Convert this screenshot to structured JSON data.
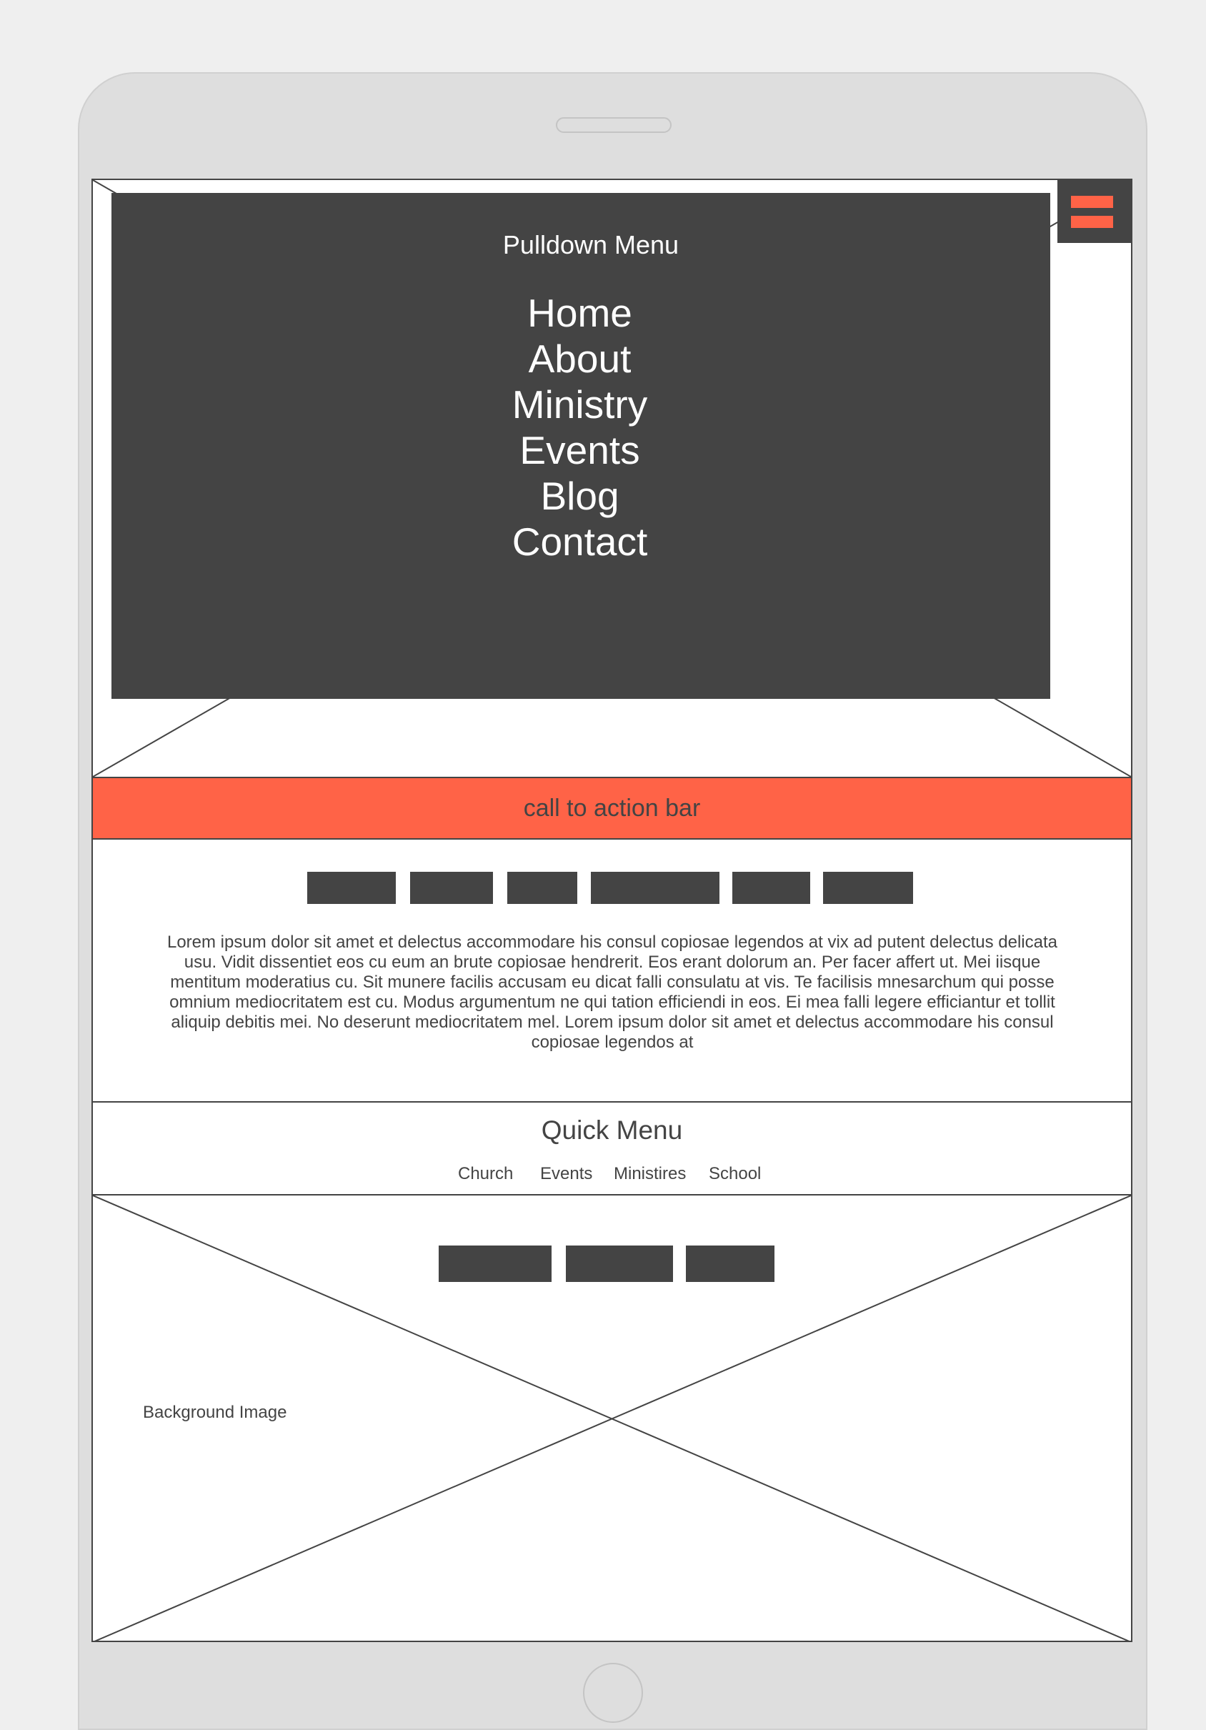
{
  "pulldown": {
    "title": "Pulldown Menu",
    "items": [
      "Home",
      "About",
      "Ministry",
      "Events",
      "Blog",
      "Contact"
    ]
  },
  "hamburger": {
    "icon": "hamburger-menu-icon"
  },
  "cta": {
    "label": "call to action bar"
  },
  "content": {
    "body": "Lorem ipsum dolor sit amet et delectus accommodare his consul copiosae legendos at vix ad putent delectus delicata usu. Vidit dissentiet eos cu eum an brute copiosae hendrerit. Eos erant dolorum an. Per facer affert ut. Mei iisque mentitum moderatius cu. Sit munere facilis accusam eu dicat falli consulatu at vis. Te facilisis mnesarchum qui posse omnium mediocritatem est cu. Modus argumentum ne qui tation efficiendi in eos. Ei mea falli legere efficiantur et tollit aliquip debitis mei. No deserunt mediocritatem mel. Lorem ipsum dolor sit amet et delectus accommodare his consul copiosae legendos at"
  },
  "quick_menu": {
    "title": "Quick Menu",
    "links": [
      "Church",
      "Events",
      "Ministires",
      "School"
    ]
  },
  "background": {
    "label": "Background Image"
  },
  "colors": {
    "accent": "#ff6347",
    "dark": "#444444",
    "device": "#dedede",
    "page": "#efefef"
  }
}
